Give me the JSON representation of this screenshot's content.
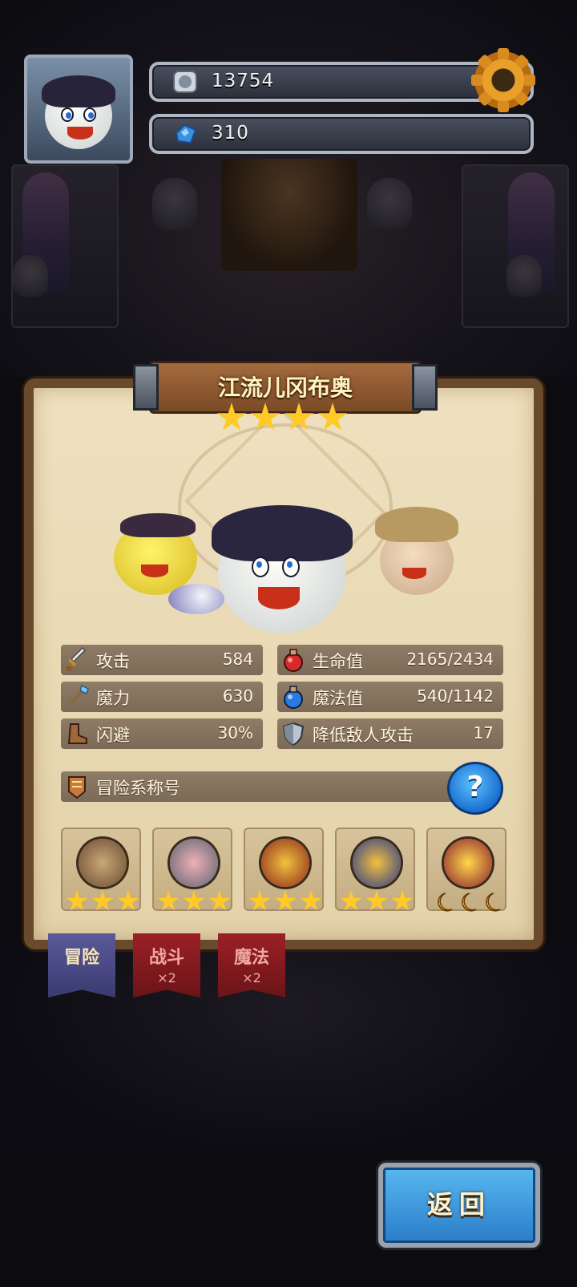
{
  "header": {
    "coins": "13754",
    "gems": "310",
    "settings_icon": "gear-icon"
  },
  "hero": {
    "name": "江流儿冈布奥",
    "stars": 4
  },
  "stats": {
    "attack_label": "攻击",
    "attack_value": "584",
    "hp_label": "生命值",
    "hp_value": "2165/2434",
    "magic_power_label": "魔力",
    "magic_power_value": "630",
    "mp_label": "魔法值",
    "mp_value": "540/1142",
    "dodge_label": "闪避",
    "dodge_value": "30%",
    "reduce_attack_label": "降低敌人攻击",
    "reduce_attack_value": "17"
  },
  "title_row": {
    "label": "冒险系称号",
    "help": "?"
  },
  "medals": [
    {
      "icon": "telescope-medal-icon",
      "stars": 3
    },
    {
      "icon": "pig-shield-medal-icon",
      "stars": 3
    },
    {
      "icon": "money-bag-medal-icon",
      "stars": 3
    },
    {
      "icon": "treasure-wreath-medal-icon",
      "stars": 3
    },
    {
      "icon": "golden-trophy-medal-icon",
      "moons": 3
    }
  ],
  "tabs": [
    {
      "label": "冒险",
      "sub": ""
    },
    {
      "label": "战斗",
      "sub": "×2"
    },
    {
      "label": "魔法",
      "sub": "×2"
    }
  ],
  "back_button": "返回",
  "colors": {
    "panel": "#e8d8b2",
    "stat_row": "#85735e",
    "accent_blue": "#2a7cc8",
    "star": "#ffc928",
    "tab_active": "#4a4a82",
    "tab_inactive": "#8a1e22"
  }
}
